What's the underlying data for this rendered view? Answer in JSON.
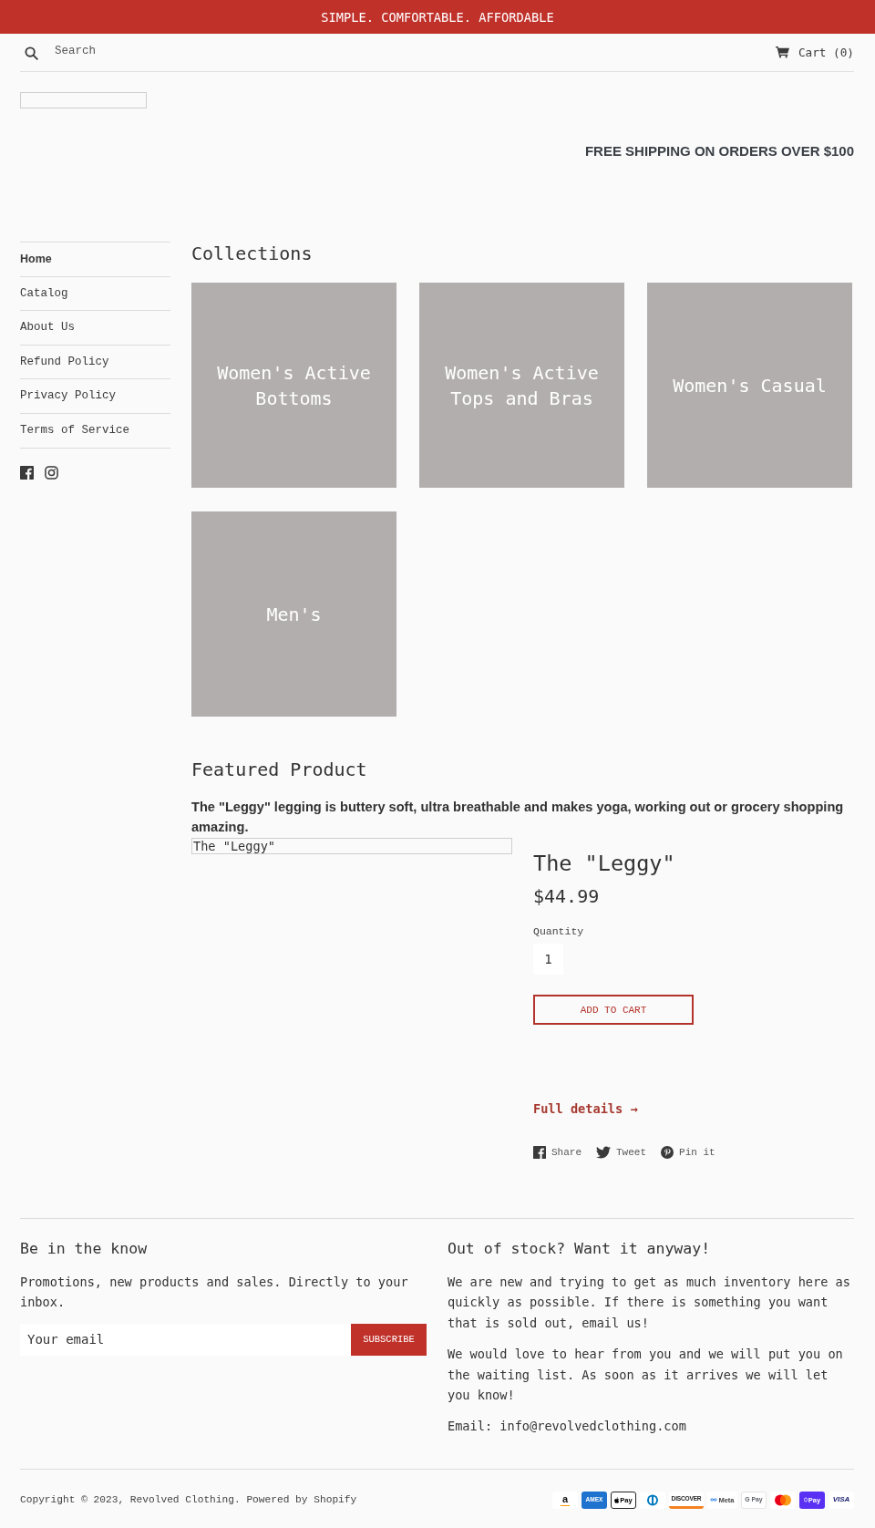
{
  "announcement": {
    "text": "SIMPLE. COMFORTABLE. AFFORDABLE"
  },
  "header": {
    "search": {
      "placeholder": "Search"
    },
    "cart": "Cart (0)"
  },
  "promo": {
    "text": "FREE SHIPPING ON ORDERS OVER $100"
  },
  "sidebar": {
    "items": [
      {
        "label": "Home",
        "selected": true
      },
      {
        "label": "Catalog",
        "selected": false
      },
      {
        "label": "About Us",
        "selected": false
      },
      {
        "label": "Refund Policy",
        "selected": false
      },
      {
        "label": "Privacy Policy",
        "selected": false
      },
      {
        "label": "Terms of Service",
        "selected": false
      }
    ]
  },
  "collections": {
    "title": "Collections",
    "items": [
      {
        "label": "Women's Active Bottoms"
      },
      {
        "label": "Women's Active Tops and Bras"
      },
      {
        "label": "Women's Casual"
      },
      {
        "label": "Men's"
      }
    ]
  },
  "featured": {
    "title": "Featured Product",
    "description": "The \"Leggy\" legging is buttery soft, ultra breathable and makes yoga, working out or grocery shopping amazing.",
    "image_alt": "The \"Leggy\"",
    "product": {
      "title": "The \"Leggy\"",
      "price": "$44.99",
      "quantity_label": "Quantity",
      "quantity": "1",
      "add_to_cart": "ADD TO CART",
      "details_link": "Full details →",
      "share": [
        {
          "kind": "facebook",
          "label": "Share"
        },
        {
          "kind": "twitter",
          "label": "Tweet"
        },
        {
          "kind": "pinterest",
          "label": "Pin it"
        }
      ]
    }
  },
  "footer": {
    "newsletter": {
      "title": "Be in the know",
      "text": "Promotions, new products and sales. Directly to your inbox.",
      "email": {
        "placeholder": "Your email"
      },
      "button": "SUBSCRIBE"
    },
    "notice": {
      "title": "Out of stock? Want it anyway!",
      "paragraphs": [
        "We are new and trying to get as much inventory here as quickly as possible. If there is something you want that is sold out, email us!",
        "We would love to hear from you and we will put you on the waiting list. As soon as it arrives we will let you know!"
      ],
      "email_line": "Email: info@revolvedclothing.com"
    }
  },
  "bottom": {
    "copyright": "Copyright © 2023, Revolved Clothing. Powered by Shopify",
    "payment_methods": [
      {
        "kind": "amazon",
        "label": "a"
      },
      {
        "kind": "amex",
        "label": "AMEX"
      },
      {
        "kind": "apple_pay",
        "label": "Pay"
      },
      {
        "kind": "diners"
      },
      {
        "kind": "discover",
        "label": "DISCOVER"
      },
      {
        "kind": "meta",
        "label": "Meta"
      },
      {
        "kind": "google_pay",
        "label": "G Pay"
      },
      {
        "kind": "mastercard"
      },
      {
        "kind": "shop_pay",
        "label": "Pay"
      },
      {
        "kind": "visa",
        "label": "VISA"
      }
    ]
  }
}
